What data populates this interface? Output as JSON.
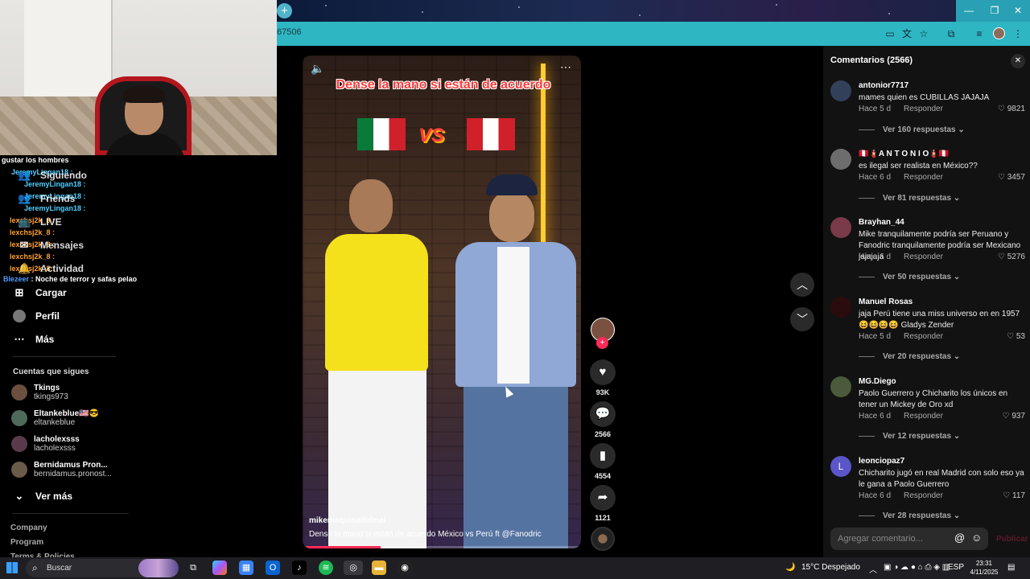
{
  "browser": {
    "url_fragment": "67506",
    "new_tab": "+",
    "window_controls": [
      "—",
      "❐",
      "✕"
    ]
  },
  "stream_chat": [
    {
      "text": "gustar los hombres",
      "color": "#ffffff"
    },
    {
      "text": "JeremyLingan18 :",
      "color": "#4fd0ff"
    },
    {
      "text": "JeremyLingan18 :",
      "color": "#4fd0ff"
    },
    {
      "text": "JeremyLingan18 :",
      "color": "#4fd0ff"
    },
    {
      "text": "JeremyLingan18 :",
      "color": "#4fd0ff"
    },
    {
      "text": "lexchsj2k_8 :",
      "color": "#ff9f2e"
    },
    {
      "text": "lexchsj2k_8 :",
      "color": "#ff9f2e"
    },
    {
      "text": "lexchsj2k_8 :",
      "color": "#ff9f2e"
    },
    {
      "text": "lexchsj2k_8 :",
      "color": "#ff9f2e"
    },
    {
      "text": "lexchsj2k_8 :",
      "color": "#ff9f2e"
    }
  ],
  "stream_chat_last": {
    "user": "Blezeer",
    "text": " : Noche de terror y safas pelao"
  },
  "sidebar": {
    "items": [
      {
        "label": "Siguiendo",
        "icon": "👥"
      },
      {
        "label": "Friends",
        "icon": "👥"
      },
      {
        "label": "LIVE",
        "icon": "📺"
      },
      {
        "label": "Mensajes",
        "icon": "✉"
      },
      {
        "label": "Actividad",
        "icon": "🔔"
      },
      {
        "label": "Cargar",
        "icon": "⊞"
      },
      {
        "label": "Perfil",
        "icon": "●"
      },
      {
        "label": "Más",
        "icon": "⋯"
      }
    ],
    "following_title": "Cuentas que sigues",
    "following": [
      {
        "name": "Tkings",
        "handle": "tkings973"
      },
      {
        "name": "Eltankeblue🇺🇸😎",
        "handle": "eltankeblue"
      },
      {
        "name": "lacholexsss",
        "handle": "lacholexsss"
      },
      {
        "name": "Bernidamus Pron...",
        "handle": "bernidamus.pronost..."
      }
    ],
    "see_more": "Ver más",
    "footer": [
      "Company",
      "Program",
      "Terms & Policies"
    ]
  },
  "video": {
    "title": "Dense la mano si están de acuerdo",
    "vs": "VS",
    "author": "mikemaquinadelmal",
    "caption": "Dense la mano si están de acuerdo México vs Perú ft @Fanodric",
    "progress": 0.28,
    "likes": "93K",
    "comments": "2566",
    "saves": "4554",
    "shares": "1121"
  },
  "comments_panel": {
    "title": "Comentarios (2566)",
    "placeholder": "Agregar comentario...",
    "post": "Publicar",
    "reply_label": "Responder",
    "items": [
      {
        "user": "antonior7717",
        "text": "mames quien es CUBILLAS JAJAJA",
        "time": "Hace 5 d",
        "likes": "9821",
        "replies": "Ver 160 respuestas",
        "avatar": ""
      },
      {
        "user": "🇵🇪🧯A N T O N I O🧯🇵🇪",
        "text": "es ilegal ser realista en México??",
        "time": "Hace 6 d",
        "likes": "3457",
        "replies": "Ver 81 respuestas",
        "avatar": ""
      },
      {
        "user": "Brayhan_44",
        "text": "Mike tranquilamente podría ser Peruano y Fanodric tranquilamente podría ser Mexicano jajajaja",
        "time": "Hace 6 d",
        "likes": "5276",
        "replies": "Ver 50 respuestas",
        "avatar": ""
      },
      {
        "user": "Manuel Rosas",
        "text": "jaja Perú tiene una miss universo en en 1957😆😆😆😆 Gladys Zender",
        "time": "Hace 5 d",
        "likes": "53",
        "replies": "Ver 20 respuestas",
        "avatar": ""
      },
      {
        "user": "MG.Diego",
        "text": "Paolo Guerrero y Chicharito los únicos en tener un Mickey de Oro xd",
        "time": "Hace 6 d",
        "likes": "937",
        "replies": "Ver 12 respuestas",
        "avatar": ""
      },
      {
        "user": "leonciopaz7",
        "text": "Chicharito jugó en real Madrid con solo eso ya le gana a Paolo Guerrero",
        "time": "Hace 6 d",
        "likes": "117",
        "replies": "Ver 28 respuestas",
        "avatar": "L"
      }
    ]
  },
  "taskbar": {
    "search": "Buscar",
    "weather": "15°C  Despejado",
    "lang": "ESP",
    "time": "23:31",
    "date": "4/11/2025"
  }
}
